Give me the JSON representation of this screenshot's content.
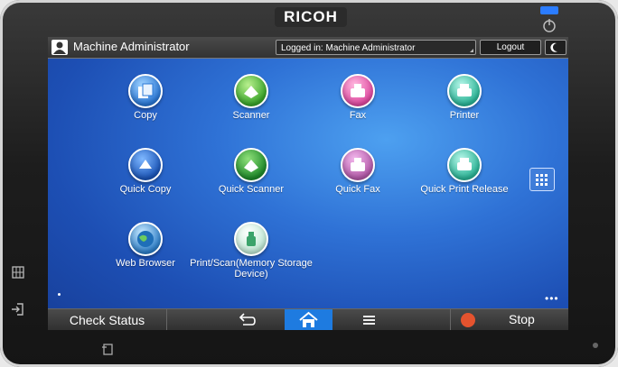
{
  "device": {
    "brand": "RICOH"
  },
  "topbar": {
    "user_label": "Machine Administrator",
    "login_status": "Logged in: Machine Administrator",
    "logout_label": "Logout"
  },
  "apps": [
    {
      "label": "Copy",
      "icon": "copy-icon"
    },
    {
      "label": "Scanner",
      "icon": "scanner-icon"
    },
    {
      "label": "Fax",
      "icon": "fax-icon"
    },
    {
      "label": "Printer",
      "icon": "printer-icon"
    },
    {
      "label": "Quick Copy",
      "icon": "quick-copy-icon"
    },
    {
      "label": "Quick Scanner",
      "icon": "quick-scanner-icon"
    },
    {
      "label": "Quick Fax",
      "icon": "quick-fax-icon"
    },
    {
      "label": "Quick Print Release",
      "icon": "quick-print-release-icon"
    },
    {
      "label": "Web Browser",
      "icon": "globe-icon"
    },
    {
      "label": "Print/Scan(Memory Storage Device)",
      "icon": "usb-icon"
    }
  ],
  "bottombar": {
    "check_status_label": "Check Status",
    "stop_label": "Stop"
  },
  "colors": {
    "accent_home": "#1e7be0",
    "stop": "#e5532e",
    "screen_bg": "#2f72d6"
  }
}
